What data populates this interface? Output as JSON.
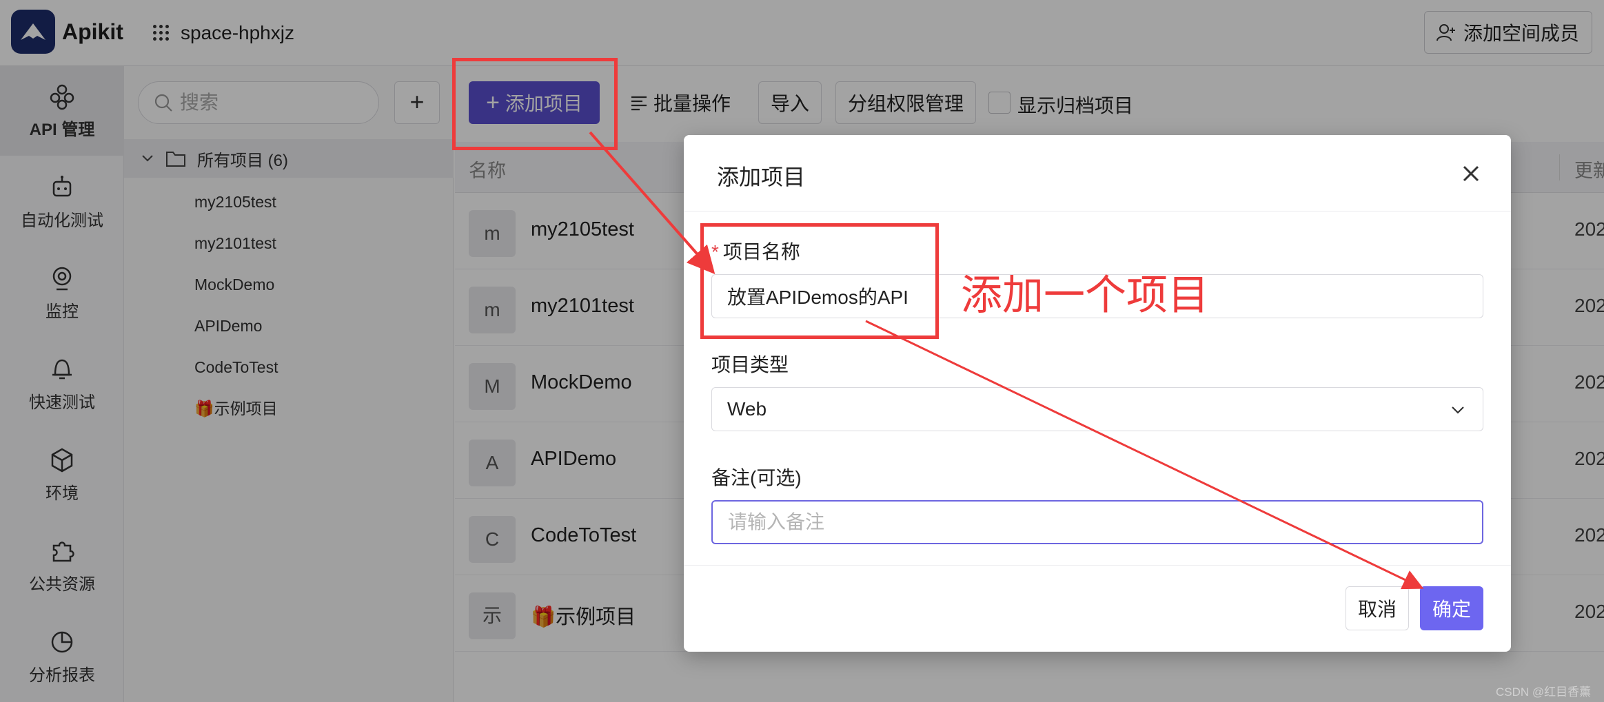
{
  "header": {
    "app_name": "Apikit",
    "space_name": "space-hphxjz",
    "invite_label": "添加空间成员"
  },
  "nav": {
    "items": [
      {
        "label": "API 管理",
        "icon": "api-icon",
        "active": true
      },
      {
        "label": "自动化测试",
        "icon": "robot-icon"
      },
      {
        "label": "监控",
        "icon": "monitor-icon"
      },
      {
        "label": "快速测试",
        "icon": "bell-icon"
      },
      {
        "label": "环境",
        "icon": "cube-icon"
      },
      {
        "label": "公共资源",
        "icon": "puzzle-icon"
      },
      {
        "label": "分析报表",
        "icon": "pie-chart-icon"
      }
    ]
  },
  "tree": {
    "search_placeholder": "搜索",
    "root_label": "所有项目 (6)",
    "items": [
      "my2105test",
      "my2101test",
      "MockDemo",
      "APIDemo",
      "CodeToTest",
      "🎁示例项目"
    ]
  },
  "toolbar": {
    "add_project": "添加项目",
    "batch": "批量操作",
    "import": "导入",
    "group_permissions": "分组权限管理",
    "show_archived": "显示归档项目"
  },
  "table": {
    "col_name": "名称",
    "col_updated": "更新",
    "rows": [
      {
        "avatar": "m",
        "name": "my2105test",
        "date": "202"
      },
      {
        "avatar": "m",
        "name": "my2101test",
        "date": "202"
      },
      {
        "avatar": "M",
        "name": "MockDemo",
        "date": "202"
      },
      {
        "avatar": "A",
        "name": "APIDemo",
        "date": "202"
      },
      {
        "avatar": "C",
        "name": "CodeToTest",
        "date": "202"
      },
      {
        "avatar": "示",
        "name": "🎁示例项目",
        "date": "202"
      }
    ]
  },
  "modal": {
    "title": "添加项目",
    "name_label": "项目名称",
    "name_required_mark": "*",
    "name_value": "放置APIDemos的API",
    "type_label": "项目类型",
    "type_value": "Web",
    "note_label": "备注(可选)",
    "note_placeholder": "请输入备注",
    "cancel": "取消",
    "ok": "确定"
  },
  "annotation": {
    "text": "添加一个项目",
    "color": "#ee3b3b"
  },
  "watermark": "CSDN @红目香薰",
  "colors": {
    "primary": "#5a4fcf",
    "confirm": "#6d66f0",
    "logo_bg": "#1d2c6b"
  }
}
